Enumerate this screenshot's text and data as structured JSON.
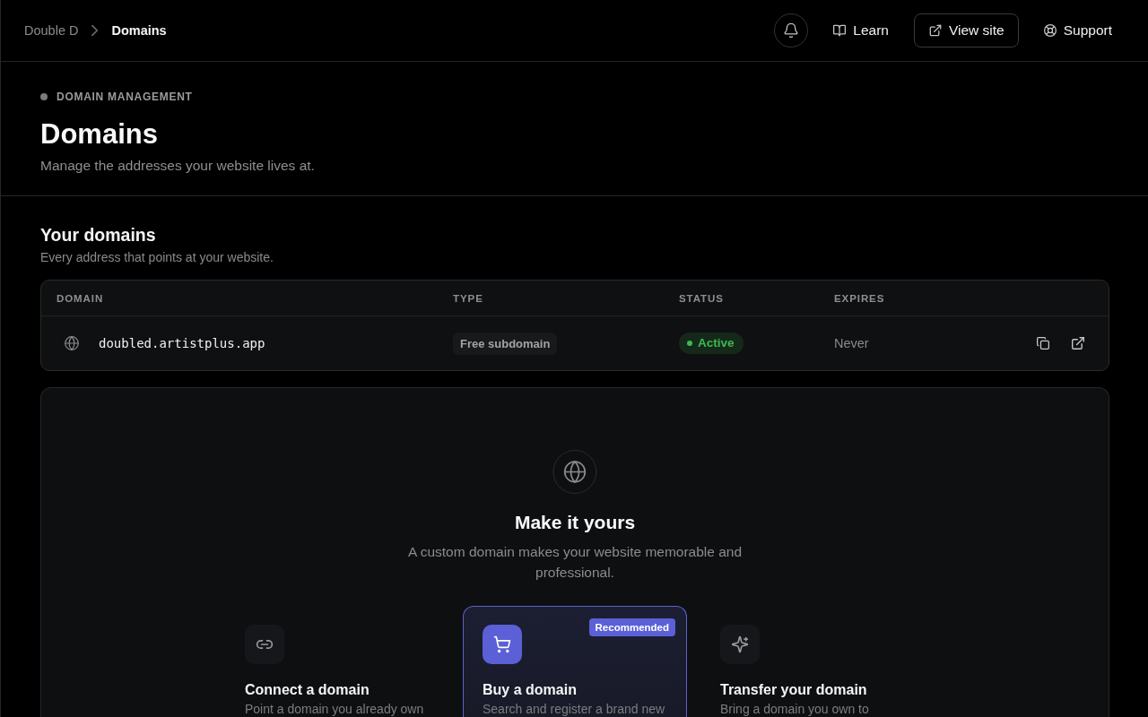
{
  "breadcrumbs": [
    {
      "label": "Double D",
      "current": false
    },
    {
      "label": "Domains",
      "current": true
    }
  ],
  "nav": [
    {
      "label": "Learn",
      "kind": "link"
    },
    {
      "label": "View site",
      "kind": "outlined"
    },
    {
      "label": "Support",
      "kind": "link"
    }
  ],
  "header": {
    "eyebrow": "DOMAIN MANAGEMENT",
    "title": "Domains",
    "subtitle": "Manage the addresses your website lives at."
  },
  "section": {
    "title": "Your domains",
    "subtitle": "Every address that points at your website."
  },
  "table": {
    "columns": [
      "DOMAIN",
      "TYPE",
      "STATUS",
      "EXPIRES"
    ],
    "rows": [
      {
        "domain": "doubled.artistplus.app",
        "type": "Free subdomain",
        "status": {
          "label": "Active",
          "color": "#3fb950"
        },
        "expires": "Never"
      }
    ]
  },
  "empty_state": {
    "title": "Make it yours",
    "description": "A custom domain makes your website memorable and professional.",
    "options": [
      {
        "title": "Connect a domain",
        "description": "Point a domain you already own",
        "recommended": false
      },
      {
        "title": "Buy a domain",
        "description": "Search and register a brand new",
        "recommended": true,
        "badge": "Recommended"
      },
      {
        "title": "Transfer your domain",
        "description": "Bring a domain you own to",
        "recommended": false
      }
    ]
  }
}
